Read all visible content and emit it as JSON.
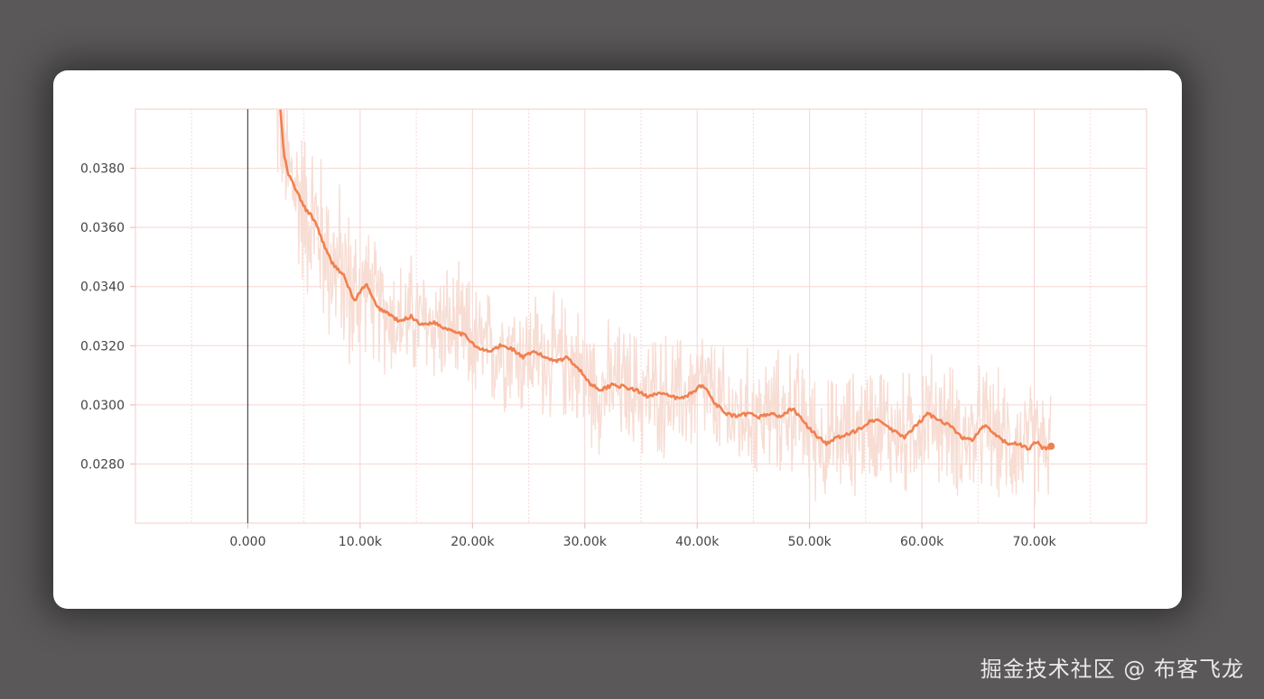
{
  "watermark": "掘金技术社区 @ 布客飞龙",
  "chart_data": {
    "type": "line",
    "title": "",
    "xlabel": "",
    "ylabel": "",
    "xlim": [
      -10000,
      80000
    ],
    "ylim": [
      0.026,
      0.04
    ],
    "x_ticks": [
      0,
      10000,
      20000,
      30000,
      40000,
      50000,
      60000,
      70000
    ],
    "x_tick_labels": [
      "0.000",
      "10.00k",
      "20.00k",
      "30.00k",
      "40.00k",
      "50.00k",
      "60.00k",
      "70.00k"
    ],
    "y_ticks": [
      0.028,
      0.03,
      0.032,
      0.034,
      0.036,
      0.038
    ],
    "y_tick_labels": [
      "0.0280",
      "0.0300",
      "0.0320",
      "0.0340",
      "0.0360",
      "0.0380"
    ],
    "grid": true,
    "colors": {
      "smoothed": "#f0804f",
      "raw": "#f7ddd4",
      "grid": "#f5d5d3",
      "axis_zero": "#555555"
    },
    "series": [
      {
        "kind": "smoothed",
        "x": [
          2900,
          3200,
          3600,
          4000,
          5000,
          6000,
          7000,
          7500,
          8500,
          9500,
          10000,
          10500,
          11500,
          12500,
          13500,
          14500,
          15500,
          16500,
          17500,
          18500,
          19500,
          20500,
          21500,
          22500,
          23500,
          24500,
          25500,
          26500,
          27500,
          28500,
          29500,
          30500,
          31500,
          32500,
          33500,
          34500,
          35500,
          36500,
          37500,
          38500,
          39500,
          40500,
          41500,
          42500,
          43500,
          44500,
          45500,
          46500,
          47500,
          48500,
          49500,
          50500,
          51500,
          52500,
          53500,
          54500,
          55500,
          56500,
          57500,
          58500,
          59500,
          60500,
          61500,
          62500,
          63500,
          64500,
          65500,
          66500,
          67500,
          68500,
          69500,
          70300,
          70700,
          71500
        ],
        "y": [
          0.04,
          0.0385,
          0.0378,
          0.0375,
          0.0367,
          0.0362,
          0.0352,
          0.0348,
          0.0344,
          0.0335,
          0.0338,
          0.0341,
          0.0333,
          0.0331,
          0.0328,
          0.033,
          0.0327,
          0.0328,
          0.0326,
          0.0325,
          0.0323,
          0.0319,
          0.0318,
          0.032,
          0.0319,
          0.0316,
          0.0318,
          0.0316,
          0.0315,
          0.0316,
          0.0312,
          0.0307,
          0.0305,
          0.0307,
          0.0306,
          0.0305,
          0.0303,
          0.0304,
          0.0303,
          0.0302,
          0.0304,
          0.0307,
          0.0301,
          0.0297,
          0.0296,
          0.0297,
          0.0296,
          0.0297,
          0.0296,
          0.0299,
          0.0294,
          0.029,
          0.0287,
          0.0289,
          0.029,
          0.0292,
          0.0295,
          0.0294,
          0.0291,
          0.0289,
          0.0293,
          0.0297,
          0.0295,
          0.0293,
          0.0289,
          0.0288,
          0.0293,
          0.029,
          0.0287,
          0.0287,
          0.0285,
          0.0288,
          0.0285,
          0.0286
        ]
      },
      {
        "kind": "raw",
        "x_range": [
          2500,
          71500
        ],
        "noise_amplitude": 0.0018
      }
    ]
  }
}
